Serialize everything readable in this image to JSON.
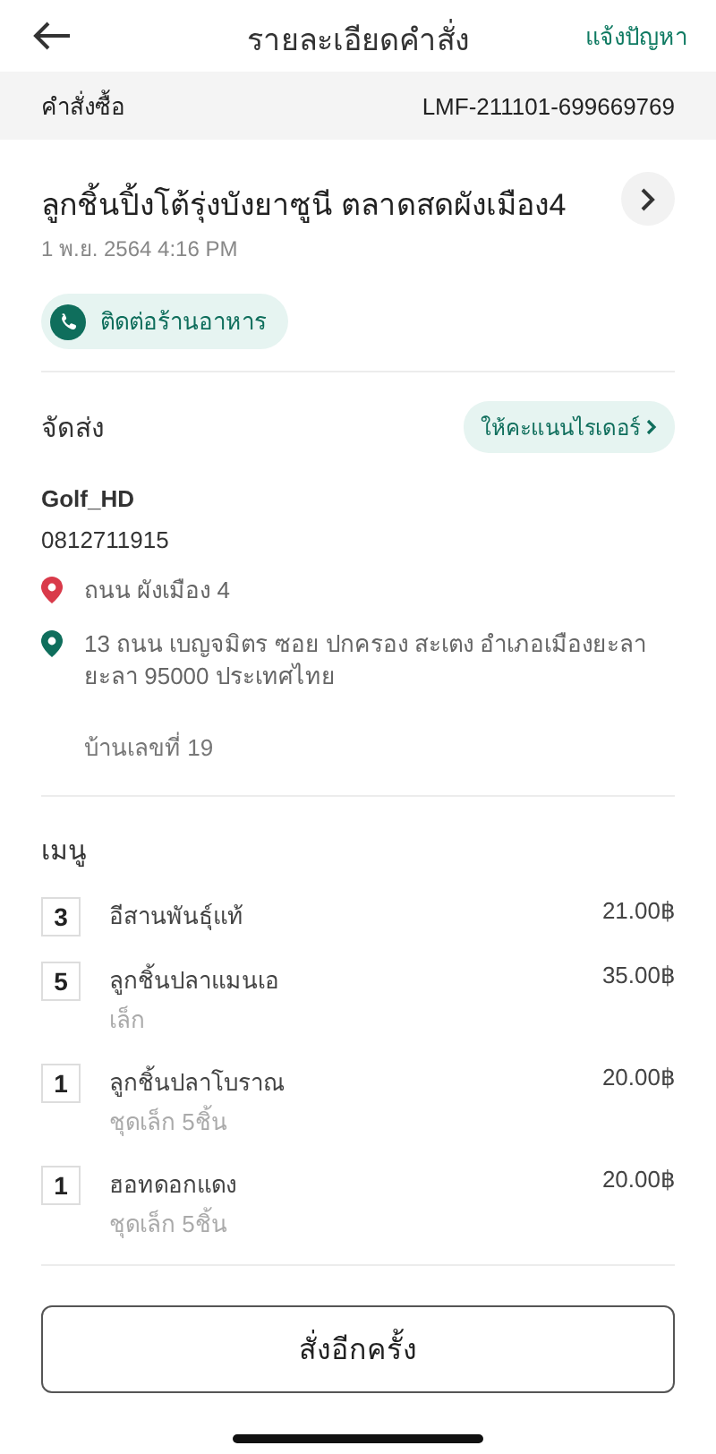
{
  "header": {
    "title": "รายละเอียดคำสั่ง",
    "action": "แจ้งปัญหา"
  },
  "order": {
    "label": "คำสั่งซื้อ",
    "number": "LMF-211101-699669769"
  },
  "store": {
    "name": "ลูกชิ้นปิ้งโต้รุ่งบังยาซูนี ตลาดสดผังเมือง4",
    "datetime": "1 พ.ย. 2564 4:16 PM",
    "contact_button": "ติดต่อร้านอาหาร"
  },
  "delivery": {
    "title": "จัดส่ง",
    "rate_button": "ให้คะแนนไรเดอร์",
    "rider_name": "Golf_HD",
    "phone": "0812711915",
    "locations": [
      {
        "address": "ถนน ผังเมือง 4",
        "color": "#d93a4a"
      },
      {
        "address": "13 ถนน เบญจมิตร ซอย ปกครอง สะเตง อำเภอเมืองยะลา ยะลา 95000 ประเทศไทย",
        "color": "#0f6e5c"
      }
    ],
    "note": "บ้านเลขที่ 19"
  },
  "menu": {
    "title": "เมนู",
    "items": [
      {
        "qty": "3",
        "name": "อีสานพันธุ์แท้",
        "price": "21.00฿"
      },
      {
        "qty": "5",
        "name": "ลูกชิ้นปลาแมนเอ",
        "option": "เล็ก",
        "price": "35.00฿"
      },
      {
        "qty": "1",
        "name": "ลูกชิ้นปลาโบราณ",
        "option": "ชุดเล็ก 5ชิ้น",
        "price": "20.00฿"
      },
      {
        "qty": "1",
        "name": "ฮอทดอกแดง",
        "option": "ชุดเล็ก 5ชิ้น",
        "price": "20.00฿"
      }
    ]
  },
  "reorder_button": "สั่งอีกครั้ง"
}
